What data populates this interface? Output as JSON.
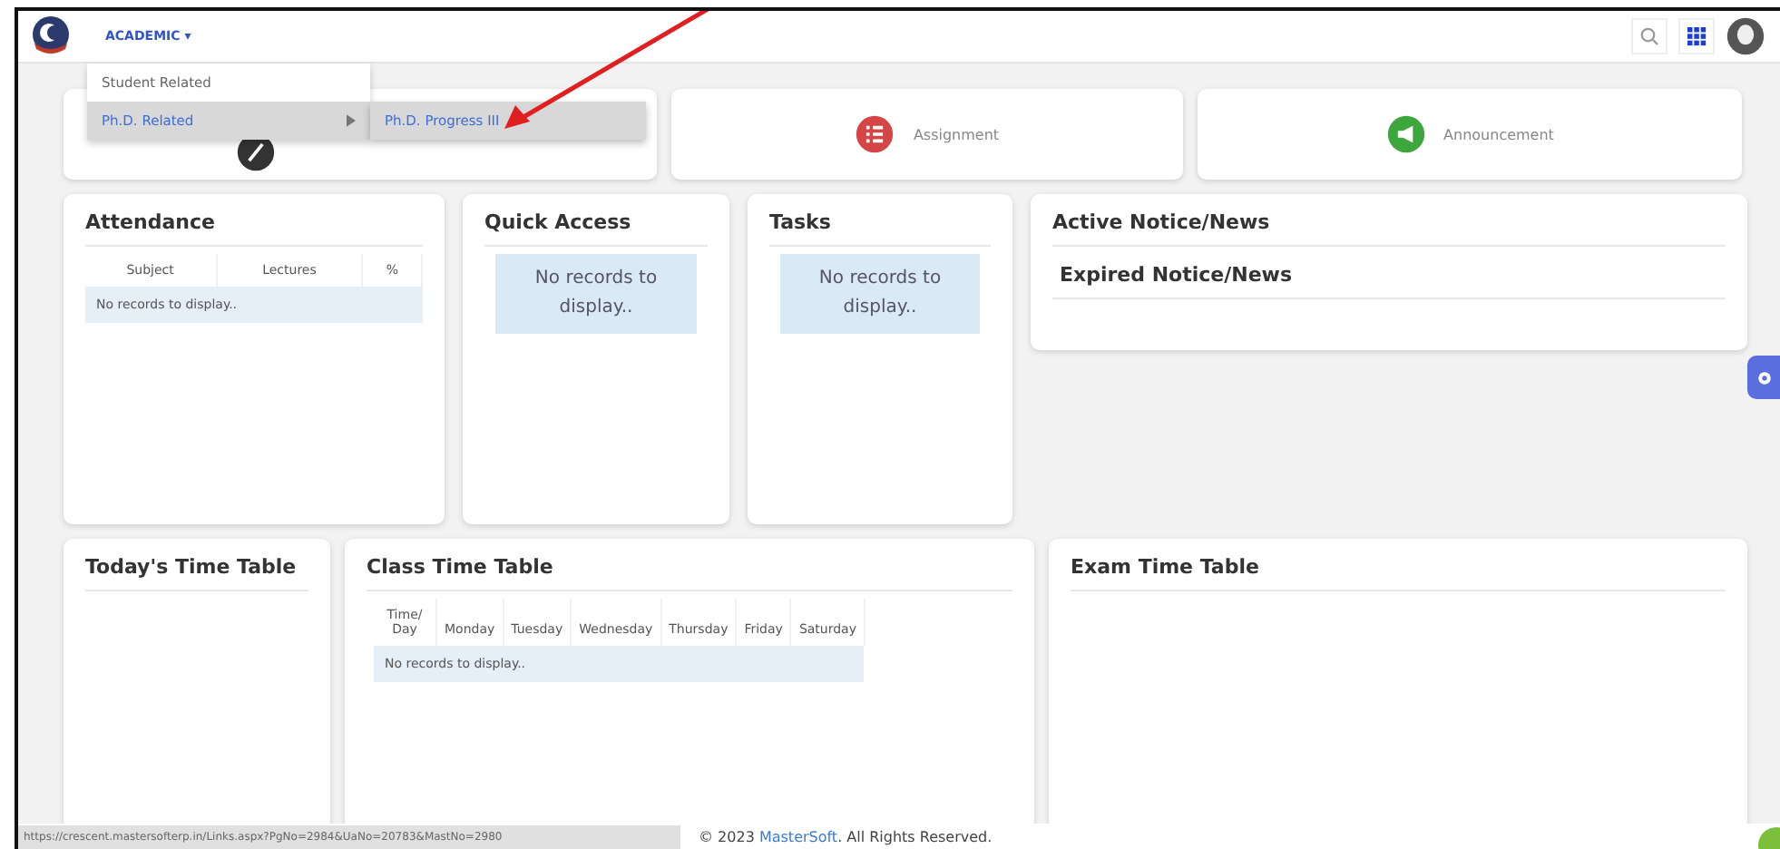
{
  "header": {
    "menu_label": "ACADEMIC",
    "menu_caret": "▾",
    "expanded": true
  },
  "dropdown": {
    "items": [
      {
        "label": "Student Related",
        "selected": false,
        "has_submenu": false
      },
      {
        "label": "Ph.D. Related",
        "selected": true,
        "has_submenu": true
      }
    ],
    "submenu_items": [
      {
        "label": "Ph.D. Progress III",
        "selected": true
      }
    ]
  },
  "stat_cards": [
    {
      "kind": "percent"
    },
    {
      "kind": "assignment",
      "label": "Assignment"
    },
    {
      "kind": "announcement",
      "label": "Announcement"
    }
  ],
  "attendance": {
    "title": "Attendance",
    "columns": [
      "Subject",
      "Lectures",
      "%"
    ],
    "empty": "No records to display.."
  },
  "quick_access": {
    "title": "Quick Access",
    "empty": "No records to display.."
  },
  "tasks": {
    "title": "Tasks",
    "empty": "No records to display.."
  },
  "notices": {
    "titles": [
      "Active Notice/News",
      "Expired Notice/News"
    ]
  },
  "todays_time_table": {
    "title": "Today's Time Table"
  },
  "class_time_table": {
    "title": "Class Time Table",
    "columns": [
      "Time/ Day",
      "Monday",
      "Tuesday",
      "Wednesday",
      "Thursday",
      "Friday",
      "Saturday"
    ],
    "empty": "No records to display.."
  },
  "exam_time_table": {
    "title": "Exam Time Table"
  },
  "status_url": "https://crescent.mastersofterp.in/Links.aspx?PgNo=2984&UaNo=20783&MastNo=2980",
  "footer": {
    "prefix": "© 2023",
    "link": "MasterSoft",
    "suffix": ". All Rights Reserved."
  }
}
